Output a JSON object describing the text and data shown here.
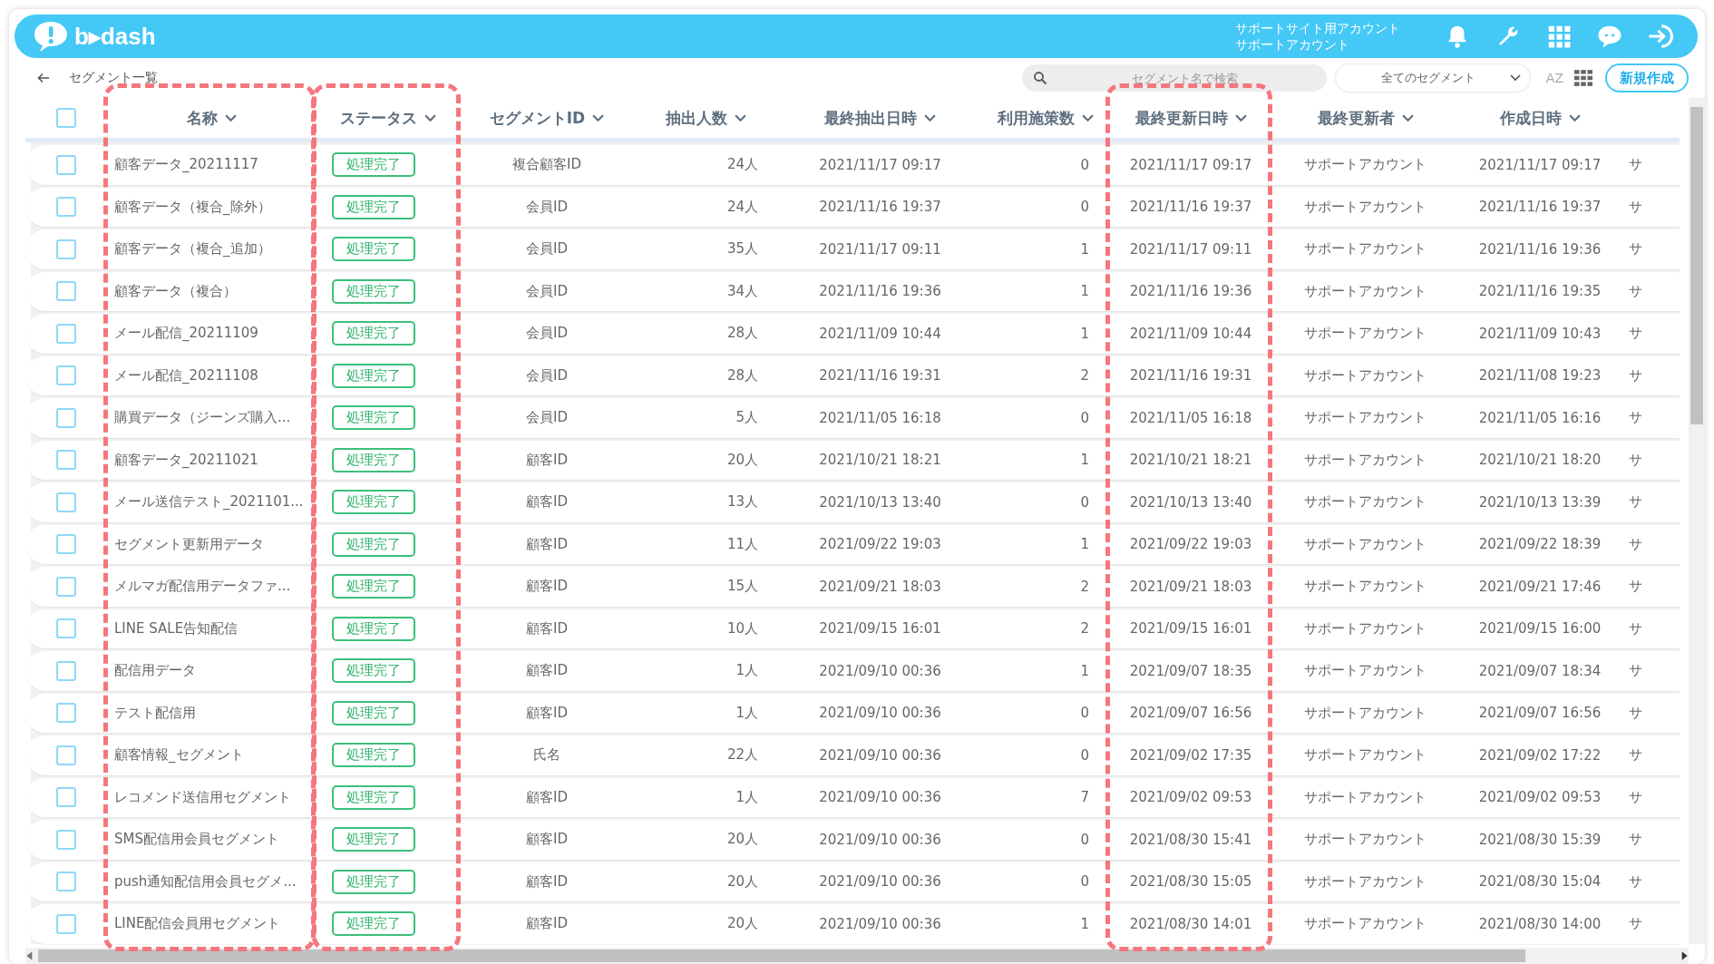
{
  "header": {
    "logo": "b▸dash",
    "account_line1": "サポートサイト用アカウント",
    "account_line2": "サポートアカウント"
  },
  "toolbar": {
    "title": "セグメント一覧",
    "search": {
      "placeholder": "セグメント名で検索"
    },
    "filter": {
      "value": "全てのセグメント"
    },
    "sort_label": "AZ",
    "create_button": "新規作成"
  },
  "table": {
    "select_all_checked": false,
    "columns": [
      {
        "label": "名称",
        "kind": "text",
        "highlighted": true
      },
      {
        "label": "ステータス",
        "kind": "badge",
        "highlighted": true
      },
      {
        "label": "セグメントID",
        "kind": "text"
      },
      {
        "label": "抽出人数",
        "kind": "text"
      },
      {
        "label": "最終抽出日時",
        "kind": "text"
      },
      {
        "label": "利用施策数",
        "kind": "text"
      },
      {
        "label": "最終更新日時",
        "kind": "text",
        "highlighted": true
      },
      {
        "label": "最終更新者",
        "kind": "text"
      },
      {
        "label": "作成日時",
        "kind": "text"
      },
      {
        "kind": "text"
      }
    ],
    "rows": [
      {
        "checked": false,
        "cells": [
          "顧客データ_20211117",
          "処理完了",
          "複合顧客ID",
          "24人",
          "2021/11/17 09:17",
          "0",
          "2021/11/17 09:17",
          "サポートアカウント",
          "2021/11/17 09:17",
          "サ"
        ]
      },
      {
        "checked": false,
        "cells": [
          "顧客データ（複合_除外）",
          "処理完了",
          "会員ID",
          "24人",
          "2021/11/16 19:37",
          "0",
          "2021/11/16 19:37",
          "サポートアカウント",
          "2021/11/16 19:37",
          "サ"
        ]
      },
      {
        "checked": false,
        "cells": [
          "顧客データ（複合_追加）",
          "処理完了",
          "会員ID",
          "35人",
          "2021/11/17 09:11",
          "1",
          "2021/11/17 09:11",
          "サポートアカウント",
          "2021/11/16 19:36",
          "サ"
        ]
      },
      {
        "checked": false,
        "cells": [
          "顧客データ（複合）",
          "処理完了",
          "会員ID",
          "34人",
          "2021/11/16 19:36",
          "1",
          "2021/11/16 19:36",
          "サポートアカウント",
          "2021/11/16 19:35",
          "サ"
        ]
      },
      {
        "checked": false,
        "cells": [
          "メール配信_20211109",
          "処理完了",
          "会員ID",
          "28人",
          "2021/11/09 10:44",
          "1",
          "2021/11/09 10:44",
          "サポートアカウント",
          "2021/11/09 10:43",
          "サ"
        ]
      },
      {
        "checked": false,
        "cells": [
          "メール配信_20211108",
          "処理完了",
          "会員ID",
          "28人",
          "2021/11/16 19:31",
          "2",
          "2021/11/16 19:31",
          "サポートアカウント",
          "2021/11/08 19:23",
          "サ"
        ]
      },
      {
        "checked": false,
        "cells": [
          "購買データ（ジーンズ購入...",
          "処理完了",
          "会員ID",
          "5人",
          "2021/11/05 16:18",
          "0",
          "2021/11/05 16:18",
          "サポートアカウント",
          "2021/11/05 16:16",
          "サ"
        ]
      },
      {
        "checked": false,
        "cells": [
          "顧客データ_20211021",
          "処理完了",
          "顧客ID",
          "20人",
          "2021/10/21 18:21",
          "1",
          "2021/10/21 18:21",
          "サポートアカウント",
          "2021/10/21 18:20",
          "サ"
        ]
      },
      {
        "checked": false,
        "cells": [
          "メール送信テスト_2021101...",
          "処理完了",
          "顧客ID",
          "13人",
          "2021/10/13 13:40",
          "0",
          "2021/10/13 13:40",
          "サポートアカウント",
          "2021/10/13 13:39",
          "サ"
        ]
      },
      {
        "checked": false,
        "cells": [
          "セグメント更新用データ",
          "処理完了",
          "顧客ID",
          "11人",
          "2021/09/22 19:03",
          "1",
          "2021/09/22 19:03",
          "サポートアカウント",
          "2021/09/22 18:39",
          "サ"
        ]
      },
      {
        "checked": false,
        "cells": [
          "メルマガ配信用データファ...",
          "処理完了",
          "顧客ID",
          "15人",
          "2021/09/21 18:03",
          "2",
          "2021/09/21 18:03",
          "サポートアカウント",
          "2021/09/21 17:46",
          "サ"
        ]
      },
      {
        "checked": false,
        "cells": [
          "LINE SALE告知配信",
          "処理完了",
          "顧客ID",
          "10人",
          "2021/09/15 16:01",
          "2",
          "2021/09/15 16:01",
          "サポートアカウント",
          "2021/09/15 16:00",
          "サ"
        ]
      },
      {
        "checked": false,
        "cells": [
          "配信用データ",
          "処理完了",
          "顧客ID",
          "1人",
          "2021/09/10 00:36",
          "1",
          "2021/09/07 18:35",
          "サポートアカウント",
          "2021/09/07 18:34",
          "サ"
        ]
      },
      {
        "checked": false,
        "cells": [
          "テスト配信用",
          "処理完了",
          "顧客ID",
          "1人",
          "2021/09/10 00:36",
          "0",
          "2021/09/07 16:56",
          "サポートアカウント",
          "2021/09/07 16:56",
          "サ"
        ]
      },
      {
        "checked": false,
        "cells": [
          "顧客情報_セグメント",
          "処理完了",
          "氏名",
          "22人",
          "2021/09/10 00:36",
          "0",
          "2021/09/02 17:35",
          "サポートアカウント",
          "2021/09/02 17:22",
          "サ"
        ]
      },
      {
        "checked": false,
        "cells": [
          "レコメンド送信用セグメント",
          "処理完了",
          "顧客ID",
          "1人",
          "2021/09/10 00:36",
          "7",
          "2021/09/02 09:53",
          "サポートアカウント",
          "2021/09/02 09:53",
          "サ"
        ]
      },
      {
        "checked": false,
        "cells": [
          "SMS配信用会員セグメント",
          "処理完了",
          "顧客ID",
          "20人",
          "2021/09/10 00:36",
          "0",
          "2021/08/30 15:41",
          "サポートアカウント",
          "2021/08/30 15:39",
          "サ"
        ]
      },
      {
        "checked": false,
        "cells": [
          "push通知配信用会員セグメ...",
          "処理完了",
          "顧客ID",
          "20人",
          "2021/09/10 00:36",
          "0",
          "2021/08/30 15:05",
          "サポートアカウント",
          "2021/08/30 15:04",
          "サ"
        ]
      },
      {
        "checked": false,
        "cells": [
          "LINE配信会員用セグメント",
          "処理完了",
          "顧客ID",
          "20人",
          "2021/09/10 00:36",
          "1",
          "2021/08/30 14:01",
          "サポートアカウント",
          "2021/08/30 14:00",
          "サ"
        ]
      }
    ]
  }
}
